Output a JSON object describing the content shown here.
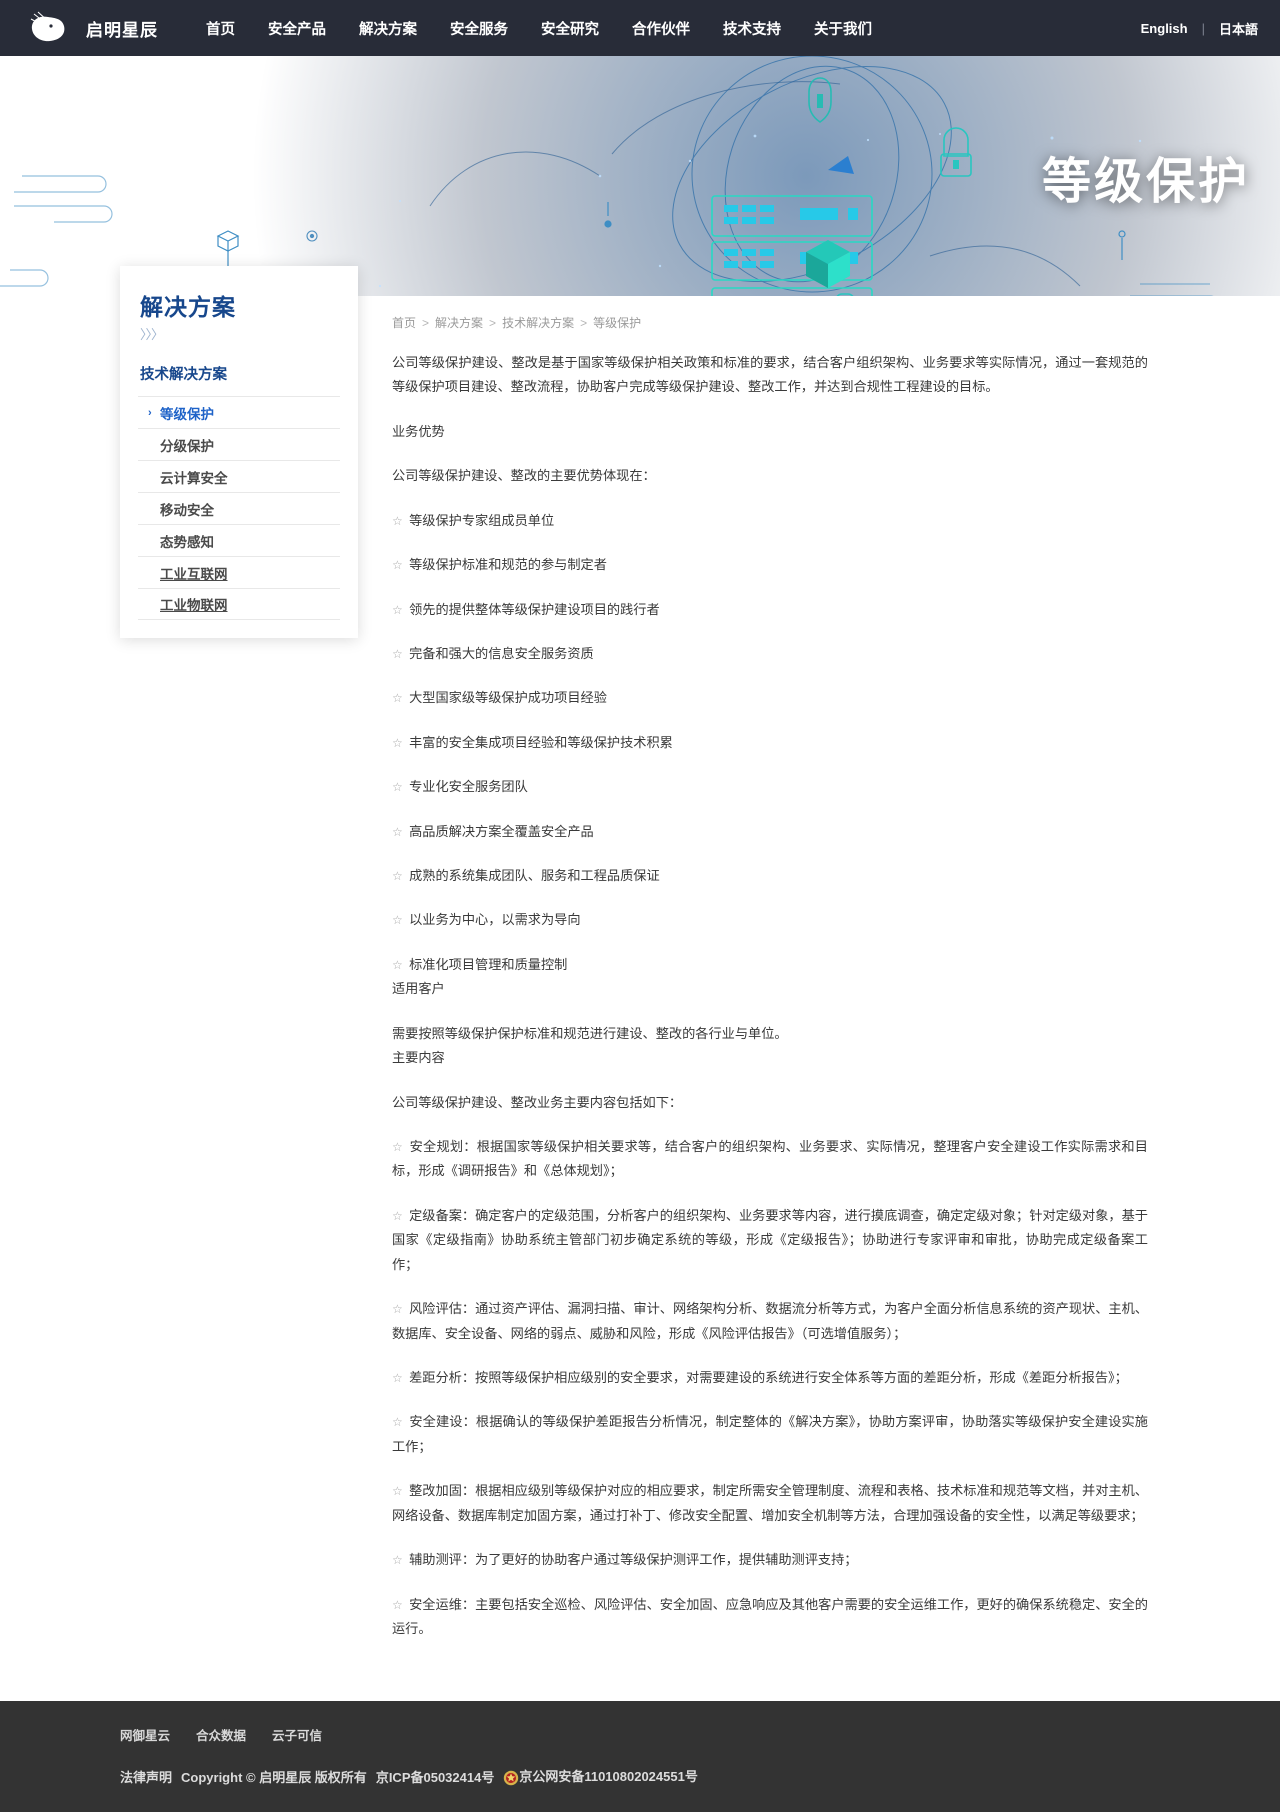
{
  "header": {
    "brand_name": "启明星辰",
    "nav": [
      {
        "label": "首页",
        "name": "nav-home"
      },
      {
        "label": "安全产品",
        "name": "nav-security-products"
      },
      {
        "label": "解决方案",
        "name": "nav-solutions"
      },
      {
        "label": "安全服务",
        "name": "nav-security-services"
      },
      {
        "label": "安全研究",
        "name": "nav-security-research"
      },
      {
        "label": "合作伙伴",
        "name": "nav-partners"
      },
      {
        "label": "技术支持",
        "name": "nav-tech-support"
      },
      {
        "label": "关于我们",
        "name": "nav-about-us"
      }
    ],
    "lang_english": "English",
    "lang_separator": "|",
    "lang_japanese": "日本語"
  },
  "hero": {
    "title": "等级保护"
  },
  "sidebar": {
    "title": "解决方案",
    "chevrons": "〉〉〉",
    "group_label": "技术解决方案",
    "items": [
      {
        "label": "等级保护",
        "active": true,
        "underline": false
      },
      {
        "label": "分级保护",
        "active": false,
        "underline": false
      },
      {
        "label": "云计算安全",
        "active": false,
        "underline": false
      },
      {
        "label": "移动安全",
        "active": false,
        "underline": false
      },
      {
        "label": "态势感知",
        "active": false,
        "underline": false
      },
      {
        "label": "工业互联网",
        "active": false,
        "underline": true
      },
      {
        "label": "工业物联网",
        "active": false,
        "underline": true
      }
    ],
    "active_caret": "›"
  },
  "breadcrumb": {
    "items": [
      "首页",
      "解决方案",
      "技术解决方案",
      "等级保护"
    ],
    "separator": ">"
  },
  "content": {
    "paragraphs": [
      {
        "text": "公司等级保护建设、整改是基于国家等级保护相关政策和标准的要求，结合客户组织架构、业务要求等实际情况，通过一套规范的等级保护项目建设、整改流程，协助客户完成等级保护建设、整改工作，并达到合规性工程建设的目标。",
        "star": false
      },
      {
        "text": "业务优势",
        "star": false
      },
      {
        "text": "公司等级保护建设、整改的主要优势体现在：",
        "star": false
      },
      {
        "text": "等级保护专家组成员单位",
        "star": true
      },
      {
        "text": "等级保护标准和规范的参与制定者",
        "star": true
      },
      {
        "text": "领先的提供整体等级保护建设项目的践行者",
        "star": true
      },
      {
        "text": "完备和强大的信息安全服务资质",
        "star": true
      },
      {
        "text": "大型国家级等级保护成功项目经验",
        "star": true
      },
      {
        "text": "丰富的安全集成项目经验和等级保护技术积累",
        "star": true
      },
      {
        "text": "专业化安全服务团队",
        "star": true
      },
      {
        "text": "高品质解决方案全覆盖安全产品",
        "star": true
      },
      {
        "text": "成熟的系统集成团队、服务和工程品质保证",
        "star": true
      },
      {
        "text": "以业务为中心，以需求为导向",
        "star": true
      },
      {
        "text": "标准化项目管理和质量控制",
        "star": true,
        "tight": true
      },
      {
        "text": "适用客户",
        "star": false
      },
      {
        "text": "需要按照等级保护保护标准和规范进行建设、整改的各行业与单位。",
        "star": false,
        "tight": true
      },
      {
        "text": "主要内容",
        "star": false
      },
      {
        "text": "公司等级保护建设、整改业务主要内容包括如下：",
        "star": false
      },
      {
        "text": "安全规划：根据国家等级保护相关要求等，结合客户的组织架构、业务要求、实际情况，整理客户安全建设工作实际需求和目标，形成《调研报告》和《总体规划》；",
        "star": true
      },
      {
        "text": "定级备案：确定客户的定级范围，分析客户的组织架构、业务要求等内容，进行摸底调查，确定定级对象；针对定级对象，基于国家《定级指南》协助系统主管部门初步确定系统的等级，形成《定级报告》；协助进行专家评审和审批，协助完成定级备案工作；",
        "star": true
      },
      {
        "text": "风险评估：通过资产评估、漏洞扫描、审计、网络架构分析、数据流分析等方式，为客户全面分析信息系统的资产现状、主机、数据库、安全设备、网络的弱点、威胁和风险，形成《风险评估报告》（可选增值服务）；",
        "star": true
      },
      {
        "text": "差距分析：按照等级保护相应级别的安全要求，对需要建设的系统进行安全体系等方面的差距分析，形成《差距分析报告》；",
        "star": true
      },
      {
        "text": "安全建设：根据确认的等级保护差距报告分析情况，制定整体的《解决方案》，协助方案评审，协助落实等级保护安全建设实施工作；",
        "star": true
      },
      {
        "text": "整改加固：根据相应级别等级保护对应的相应要求，制定所需安全管理制度、流程和表格、技术标准和规范等文档，并对主机、网络设备、数据库制定加固方案，通过打补丁、修改安全配置、增加安全机制等方法，合理加强设备的安全性，以满足等级要求；",
        "star": true
      },
      {
        "text": "辅助测评：为了更好的协助客户通过等级保护测评工作，提供辅助测评支持；",
        "star": true
      },
      {
        "text": "安全运维：主要包括安全巡检、风险评估、安全加固、应急响应及其他客户需要的安全运维工作，更好的确保系统稳定、安全的运行。",
        "star": true
      }
    ],
    "star_glyph": "☆"
  },
  "footer": {
    "links": [
      "网御星云",
      "合众数据",
      "云子可信"
    ],
    "legal_label": "法律声明",
    "copyright": "Copyright © 启明星辰 版权所有",
    "icp": "京ICP备05032414号",
    "police": "京公网安备11010802024551号"
  },
  "colors": {
    "nav_bg": "#282c38",
    "hero_bg": "#0a2250",
    "accent_blue": "#17478c",
    "active_blue": "#1f63c8",
    "footer_bg": "#333333",
    "body_text": "#3a3a3a"
  }
}
